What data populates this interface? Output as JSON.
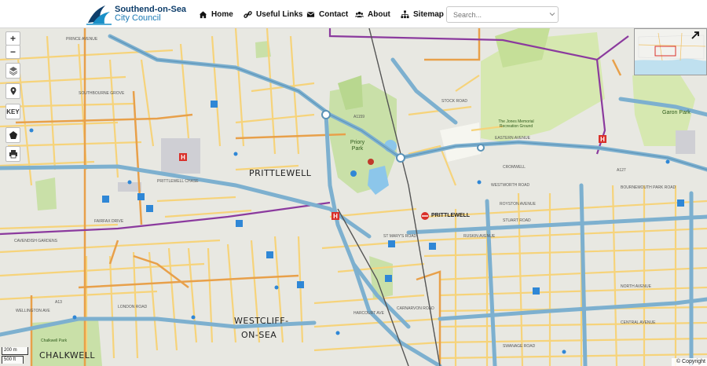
{
  "header": {
    "logo_line1": "Southend-on-Sea",
    "logo_line2": "City Council",
    "nav": [
      {
        "label": "Home",
        "icon": "home-icon"
      },
      {
        "label": "Useful Links",
        "icon": "link-icon"
      },
      {
        "label": "Contact",
        "icon": "envelope-icon"
      },
      {
        "label": "About",
        "icon": "users-icon"
      },
      {
        "label": "Sitemap",
        "icon": "sitemap-icon"
      }
    ],
    "search_placeholder": "Search..."
  },
  "map_controls": {
    "zoom_in": "+",
    "zoom_out": "−",
    "key": "KEY"
  },
  "map": {
    "areas": [
      "PRITTLEWELL",
      "WESTCLIFF-",
      "ON-SEA",
      "CHALKWELL"
    ],
    "stations": [
      "PRITTLEWELL"
    ],
    "parks": [
      "Priory Park",
      "The Jones Memorial Recreation Ground",
      "Garon Park",
      "Chalkwell Park"
    ],
    "roads": [
      "PRINCE AVENUE",
      "EASTERN AVENUE",
      "PRITTLEWELL CHASE",
      "FAIRFAX DRIVE",
      "STOCK ROAD",
      "WESTWORTH ROAD",
      "ROYSTON AVENUE",
      "STUART ROAD",
      "RUSKIN AVENUE",
      "CROMWELL",
      "BOURNEMOUTH PARK ROAD",
      "NORTH AVENUE",
      "CENTRAL AVENUE",
      "ST MARY'S ROAD",
      "LONDON ROAD",
      "A13",
      "A127",
      "A1159",
      "CARNARVON ROAD",
      "HARCOURT AVE",
      "CAVENDISH GARDENS",
      "WELLINGTON AVE",
      "SOUTHBOURNE GROVE",
      "SWANAGE ROAD"
    ]
  },
  "scale": {
    "top": "200 m",
    "bottom": "500 ft"
  },
  "copyright": "© Copyright"
}
